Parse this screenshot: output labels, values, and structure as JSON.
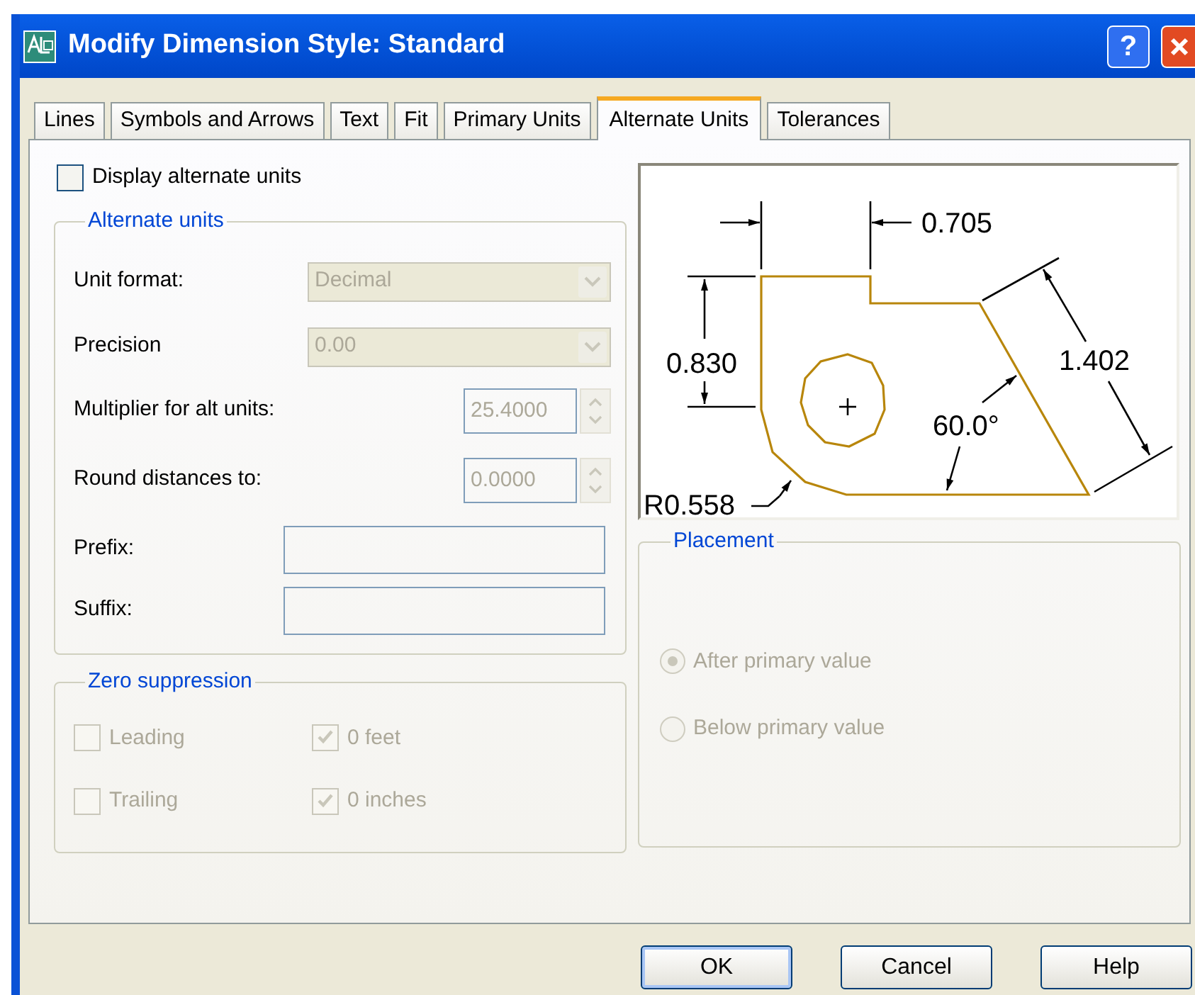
{
  "window": {
    "title": "Modify Dimension Style: Standard",
    "help_button": "?"
  },
  "tabs": [
    {
      "label": "Lines",
      "selected": false
    },
    {
      "label": "Symbols and Arrows",
      "selected": false
    },
    {
      "label": "Text",
      "selected": false
    },
    {
      "label": "Fit",
      "selected": false
    },
    {
      "label": "Primary Units",
      "selected": false
    },
    {
      "label": "Alternate Units",
      "selected": true
    },
    {
      "label": "Tolerances",
      "selected": false
    }
  ],
  "display_alternate_units": {
    "label": "Display alternate units",
    "checked": false
  },
  "alternate_units": {
    "title": "Alternate units",
    "disabled": true,
    "unit_format": {
      "label": "Unit format:",
      "value": "Decimal"
    },
    "precision": {
      "label": "Precision",
      "value": "0.00"
    },
    "multiplier": {
      "label": "Multiplier for alt units:",
      "value": "25.4000"
    },
    "round_distances": {
      "label": "Round distances  to:",
      "value": "0.0000"
    },
    "prefix": {
      "label": "Prefix:"
    },
    "suffix": {
      "label": "Suffix:"
    }
  },
  "zero_suppression": {
    "title": "Zero suppression",
    "disabled": true,
    "items": [
      {
        "label": "Leading",
        "checked": false
      },
      {
        "label": "0 feet",
        "checked": true
      },
      {
        "label": "Trailing",
        "checked": false
      },
      {
        "label": "0 inches",
        "checked": true
      }
    ]
  },
  "preview": {
    "top_dimension": "0.705",
    "left_dimension": "0.830",
    "right_dimension": "1.402",
    "angle": "60.0°",
    "radius": "R0.558"
  },
  "placement": {
    "title": "Placement",
    "disabled": true,
    "options": [
      {
        "label": "After primary value",
        "selected": true
      },
      {
        "label": "Below primary value",
        "selected": false
      }
    ]
  },
  "buttons": [
    {
      "label": "OK",
      "default": true
    },
    {
      "label": "Cancel",
      "default": false
    },
    {
      "label": "Help",
      "default": false
    }
  ]
}
